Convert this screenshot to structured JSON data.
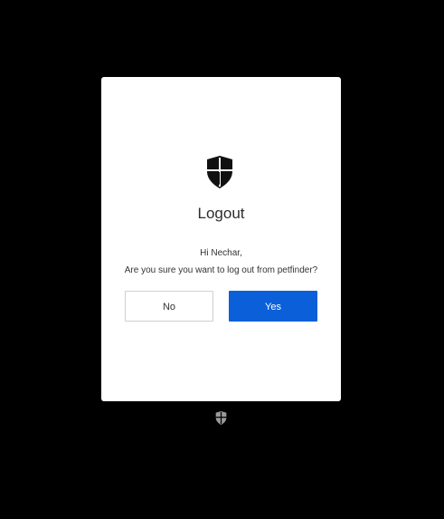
{
  "dialog": {
    "title": "Logout",
    "greeting": "Hi Nechar,",
    "question": "Are you sure you want to log out from petfinder?",
    "no_label": "No",
    "yes_label": "Yes"
  },
  "icons": {
    "logo": "shield-logo-icon",
    "footer_logo": "shield-logo-icon"
  },
  "colors": {
    "background": "#000000",
    "card": "#ffffff",
    "primary": "#0b5fd9",
    "footer_logo": "#9a9a9a"
  }
}
